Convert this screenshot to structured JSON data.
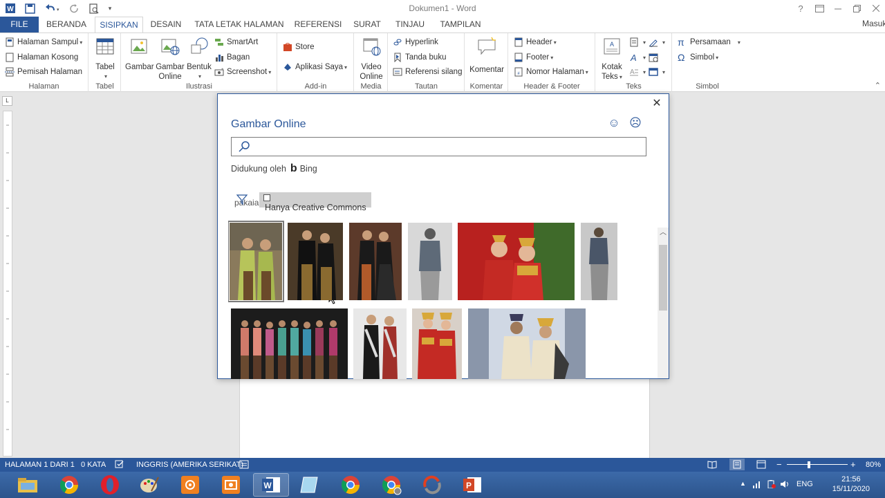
{
  "window": {
    "title": "Dokumen1 - Word",
    "help": "?",
    "controls": [
      "minimize",
      "restore",
      "close"
    ]
  },
  "tabs": {
    "file": "FILE",
    "items": [
      "BERANDA",
      "SISIPKAN",
      "DESAIN",
      "TATA LETAK HALAMAN",
      "REFERENSI",
      "SURAT",
      "TINJAU",
      "TAMPILAN"
    ],
    "active": "SISIPKAN",
    "signin": "Masuk"
  },
  "ribbon": {
    "halaman": {
      "label": "Halaman",
      "items": [
        "Halaman Sampul",
        "Halaman Kosong",
        "Pemisah Halaman"
      ]
    },
    "tabel": {
      "label": "Tabel",
      "button": "Tabel"
    },
    "ilustrasi": {
      "label": "Ilustrasi",
      "gambar": "Gambar",
      "gambar_online_1": "Gambar",
      "gambar_online_2": "Online",
      "bentuk": "Bentuk",
      "smartart": "SmartArt",
      "bagan": "Bagan",
      "screenshot": "Screenshot"
    },
    "addin": {
      "label": "Add-in",
      "store": "Store",
      "aplikasi": "Aplikasi Saya"
    },
    "media": {
      "label": "Media",
      "video_1": "Video",
      "video_2": "Online"
    },
    "tautan": {
      "label": "Tautan",
      "items": [
        "Hyperlink",
        "Tanda buku",
        "Referensi silang"
      ]
    },
    "komentar": {
      "label": "Komentar",
      "button": "Komentar"
    },
    "header_footer": {
      "label": "Header & Footer",
      "items": [
        "Header",
        "Footer",
        "Nomor Halaman"
      ]
    },
    "teks": {
      "label": "Teks",
      "kotak_1": "Kotak",
      "kotak_2": "Teks"
    },
    "simbol": {
      "label": "Simbol",
      "persamaan": "Persamaan",
      "simbol": "Simbol"
    }
  },
  "dialog": {
    "title": "Gambar Online",
    "search_value": "pakaian+adat+jawa",
    "powered_by": "Didukung oleh",
    "bing": "Bing",
    "creative_commons": "Hanya Creative Commons",
    "results_count_row1": 6,
    "results_count_row2": 4
  },
  "statusbar": {
    "page": "HALAMAN 1 DARI 1",
    "words": "0 KATA",
    "language": "INGGRIS (AMERIKA SERIKAT)",
    "zoom": "80%"
  },
  "taskbar": {
    "language": "ENG",
    "time": "21:56",
    "date": "15/11/2020"
  },
  "colors": {
    "accent": "#2b579a",
    "taskbar": "#2c548c"
  }
}
